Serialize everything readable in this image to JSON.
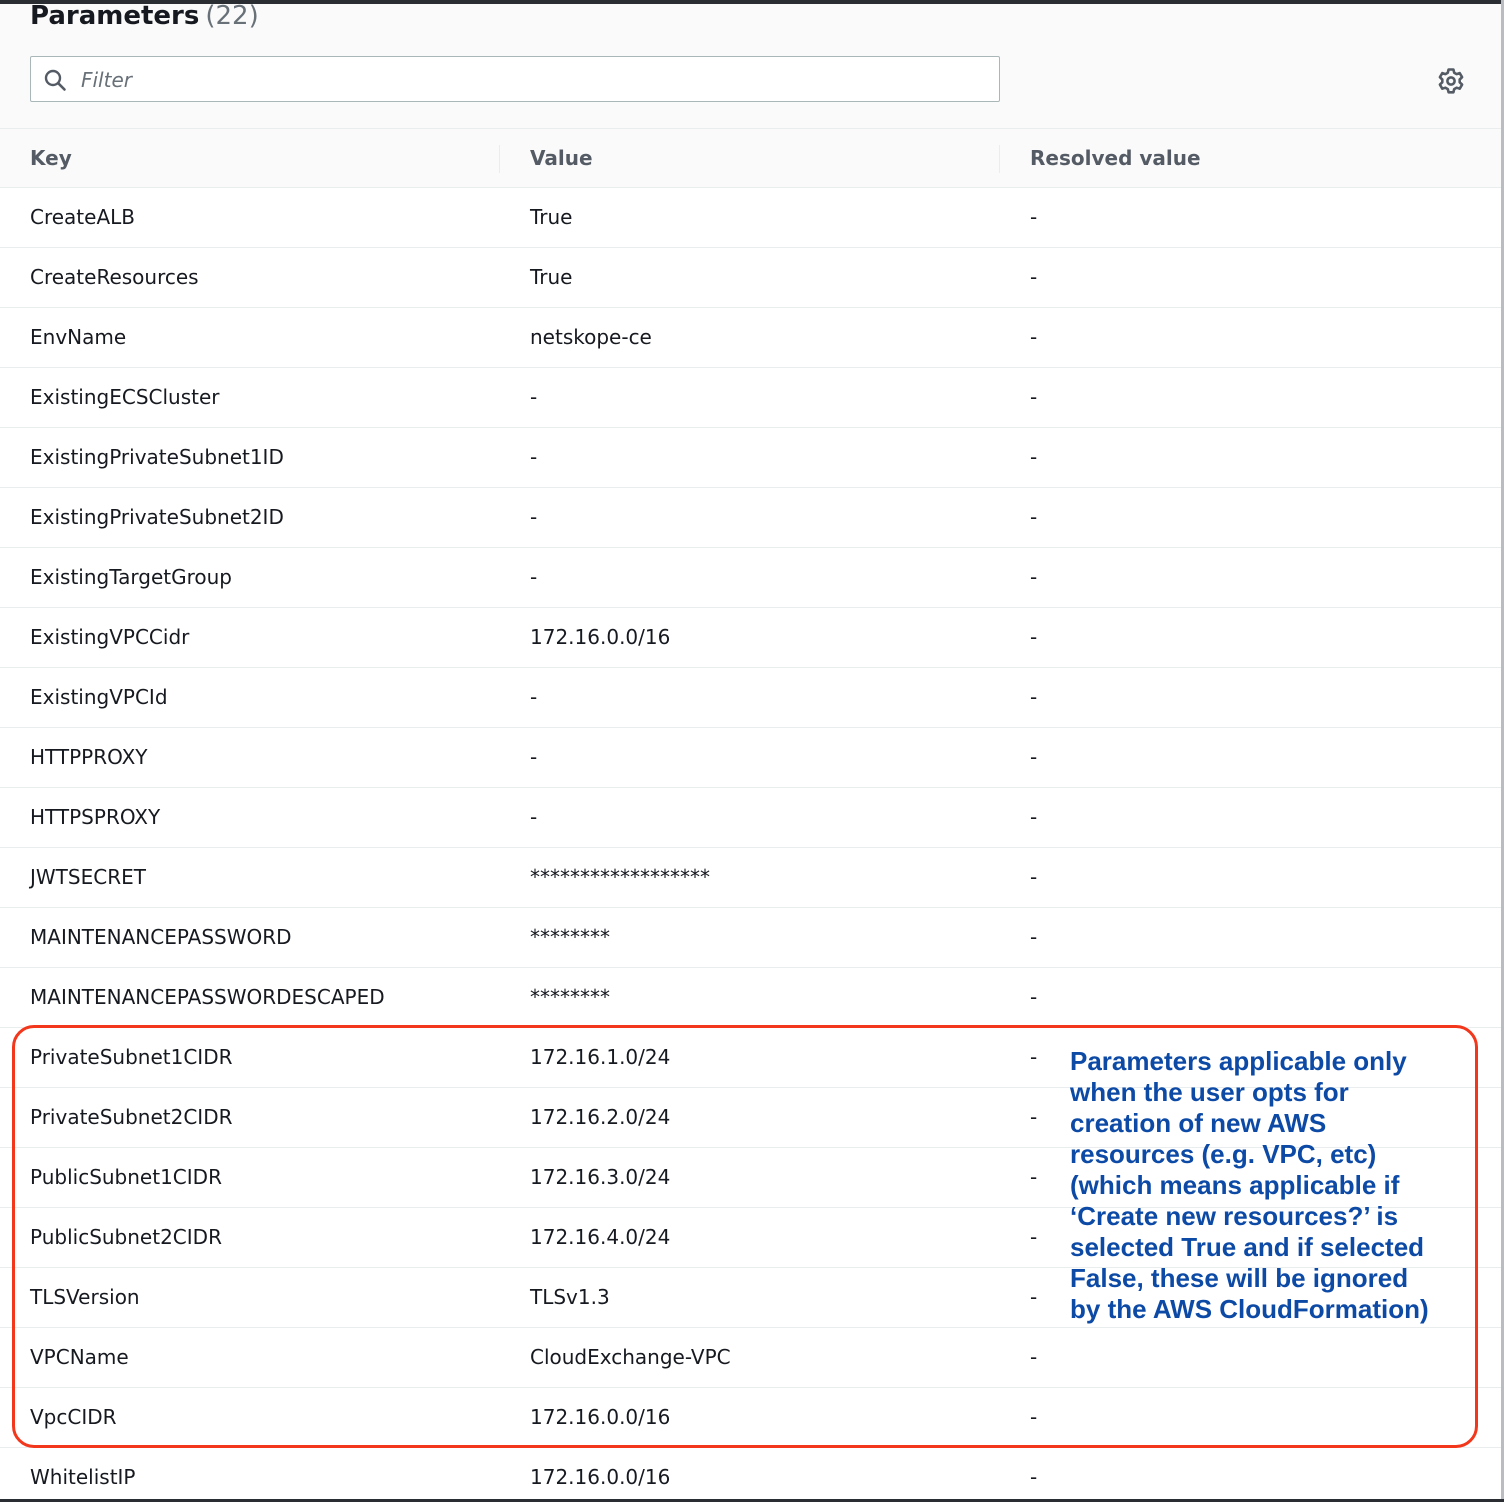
{
  "panel": {
    "title": "Parameters",
    "count": "(22)"
  },
  "filter": {
    "placeholder": "Filter",
    "value": ""
  },
  "icons": {
    "search": "search-icon",
    "settings": "gear-icon"
  },
  "table": {
    "columns": [
      "Key",
      "Value",
      "Resolved value"
    ],
    "rows": [
      {
        "key": "CreateALB",
        "value": "True",
        "resolved": "-"
      },
      {
        "key": "CreateResources",
        "value": "True",
        "resolved": "-"
      },
      {
        "key": "EnvName",
        "value": "netskope-ce",
        "resolved": "-"
      },
      {
        "key": "ExistingECSCluster",
        "value": "-",
        "resolved": "-"
      },
      {
        "key": "ExistingPrivateSubnet1ID",
        "value": "-",
        "resolved": "-"
      },
      {
        "key": "ExistingPrivateSubnet2ID",
        "value": "-",
        "resolved": "-"
      },
      {
        "key": "ExistingTargetGroup",
        "value": "-",
        "resolved": "-"
      },
      {
        "key": "ExistingVPCCidr",
        "value": "172.16.0.0/16",
        "resolved": "-"
      },
      {
        "key": "ExistingVPCId",
        "value": "-",
        "resolved": "-"
      },
      {
        "key": "HTTPPROXY",
        "value": "-",
        "resolved": "-"
      },
      {
        "key": "HTTPSPROXY",
        "value": "-",
        "resolved": "-"
      },
      {
        "key": "JWTSECRET",
        "value": "******************",
        "resolved": "-"
      },
      {
        "key": "MAINTENANCEPASSWORD",
        "value": "********",
        "resolved": "-"
      },
      {
        "key": "MAINTENANCEPASSWORDESCAPED",
        "value": "********",
        "resolved": "-"
      },
      {
        "key": "PrivateSubnet1CIDR",
        "value": "172.16.1.0/24",
        "resolved": "-"
      },
      {
        "key": "PrivateSubnet2CIDR",
        "value": "172.16.2.0/24",
        "resolved": "-"
      },
      {
        "key": "PublicSubnet1CIDR",
        "value": "172.16.3.0/24",
        "resolved": "-"
      },
      {
        "key": "PublicSubnet2CIDR",
        "value": "172.16.4.0/24",
        "resolved": "-"
      },
      {
        "key": "TLSVersion",
        "value": "TLSv1.3",
        "resolved": "-"
      },
      {
        "key": "VPCName",
        "value": "CloudExchange-VPC",
        "resolved": "-"
      },
      {
        "key": "VpcCIDR",
        "value": "172.16.0.0/16",
        "resolved": "-"
      },
      {
        "key": "WhitelistIP",
        "value": "172.16.0.0/16",
        "resolved": "-"
      }
    ]
  },
  "annotation": {
    "text": "Parameters applicable only\nwhen the user opts for\ncreation of new AWS\nresources (e.g. VPC, etc)\n(which means applicable if\n‘Create new resources?’ is\nselected True and if selected\nFalse, these will be ignored\nby the AWS CloudFormation)"
  },
  "colors": {
    "highlight_border": "#f2371c",
    "annotation_text": "#0d4aa6",
    "header_bg": "#fafafa",
    "row_divider": "#eaeded"
  }
}
